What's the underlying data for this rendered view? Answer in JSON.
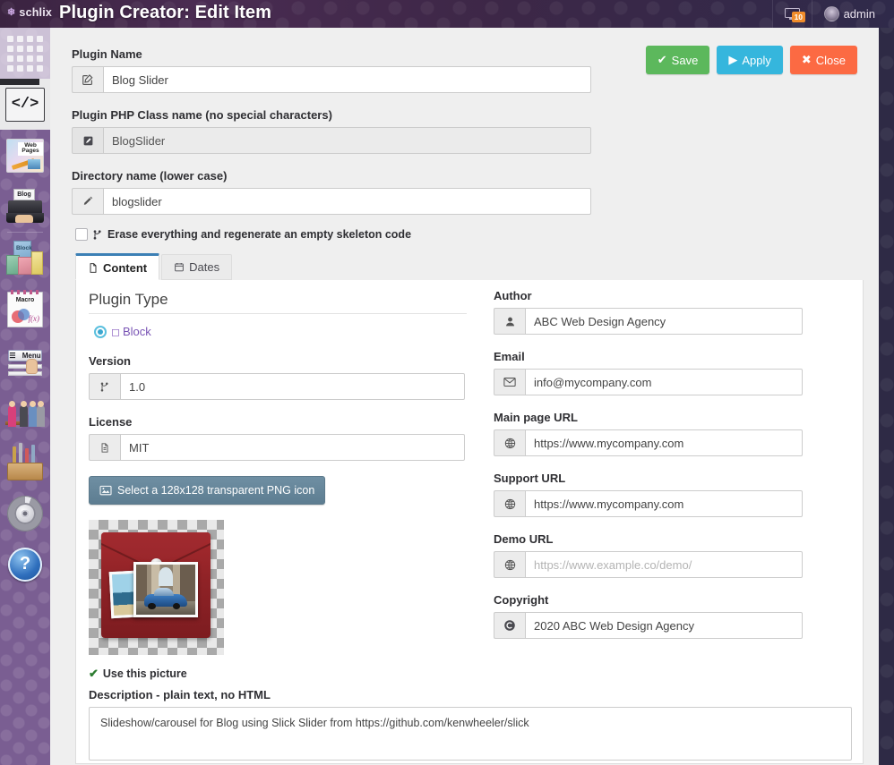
{
  "app": {
    "brand": "schlix",
    "title": "Plugin Creator: Edit Item",
    "notifications_badge": "10",
    "username": "admin"
  },
  "sidebar": {
    "items": [
      {
        "name": "dashboard",
        "icon": "grid-icon",
        "label": ""
      },
      {
        "name": "code",
        "icon": "code-icon",
        "label": "</>"
      },
      {
        "name": "web-pages",
        "icon": "web-pages-icon",
        "label": "Web Pages"
      },
      {
        "name": "blog",
        "icon": "blog-icon",
        "label": "Blog"
      },
      {
        "name": "blocks",
        "icon": "block-icon",
        "label": "Block"
      },
      {
        "name": "macro",
        "icon": "macro-icon",
        "label": "Macro"
      },
      {
        "name": "menu",
        "icon": "menu-icon",
        "label": "Menu"
      },
      {
        "name": "users",
        "icon": "users-icon",
        "label": ""
      },
      {
        "name": "tools",
        "icon": "toolbox-icon",
        "label": ""
      },
      {
        "name": "settings",
        "icon": "gear-icon",
        "label": ""
      },
      {
        "name": "help",
        "icon": "help-icon",
        "label": "?"
      }
    ]
  },
  "toolbar": {
    "save_label": "Save",
    "apply_label": "Apply",
    "close_label": "Close"
  },
  "form": {
    "plugin_name": {
      "label": "Plugin Name",
      "value": "Blog Slider",
      "icon": "edit-square-icon"
    },
    "php_class": {
      "label": "Plugin PHP Class name (no special characters)",
      "value": "BlogSlider",
      "icon": "edit-filled-icon"
    },
    "directory": {
      "label": "Directory name (lower case)",
      "value": "blogslider",
      "icon": "pencil-icon"
    },
    "regenerate": {
      "label": "Erase everything and regenerate an empty skeleton code",
      "checked": false,
      "icon": "branch-icon"
    }
  },
  "tabs": [
    {
      "label": "Content",
      "icon": "document-icon",
      "active": true
    },
    {
      "label": "Dates",
      "icon": "calendar-icon",
      "active": false
    }
  ],
  "content": {
    "plugin_type": {
      "heading": "Plugin Type",
      "options": [
        {
          "label": "Block",
          "selected": true,
          "icon": "cube-icon"
        }
      ]
    },
    "version": {
      "label": "Version",
      "value": "1.0",
      "icon": "branch-icon"
    },
    "license": {
      "label": "License",
      "value": "MIT",
      "icon": "document-icon"
    },
    "png_button": {
      "label": "Select a 128x128 transparent PNG icon",
      "icon": "image-icon"
    },
    "use_picture": {
      "label": "Use this picture",
      "icon": "check-icon"
    },
    "description": {
      "label": "Description - plain text, no HTML",
      "value": "Slideshow/carousel for Blog using Slick Slider from https://github.com/kenwheeler/slick"
    },
    "author": {
      "label": "Author",
      "value": "ABC Web Design Agency",
      "icon": "user-icon"
    },
    "email": {
      "label": "Email",
      "value": "info@mycompany.com",
      "icon": "envelope-icon"
    },
    "main_url": {
      "label": "Main page URL",
      "value": "https://www.mycompany.com",
      "icon": "globe-icon"
    },
    "support_url": {
      "label": "Support URL",
      "value": "https://www.mycompany.com",
      "icon": "globe-icon"
    },
    "demo_url": {
      "label": "Demo URL",
      "value": "",
      "placeholder": "https://www.example.co/demo/",
      "icon": "globe-icon"
    },
    "copyright": {
      "label": "Copyright",
      "value": "2020 ABC Web Design Agency",
      "icon": "copyright-icon"
    }
  },
  "colors": {
    "save": "#5cb85c",
    "apply": "#35b6dd",
    "close": "#fc6a43",
    "accent_tab": "#3b7fb5",
    "radio": "#3ba7d0",
    "block_label": "#7a55b5",
    "png_button": "#6f8fa3",
    "sidebar": "#7a5e92",
    "badge": "#f08c2b"
  }
}
